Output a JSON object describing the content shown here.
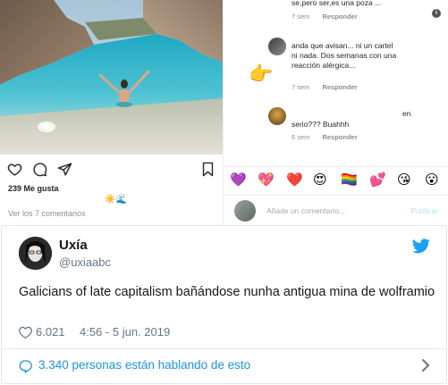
{
  "instagram": {
    "likes": "239 Me gusta",
    "caption_emoji": "☀️🌊",
    "view_comments": "Ver los 7 comentarios",
    "comments": [
      {
        "text": "se,pero ser,es una poza ...",
        "time": "7 sem",
        "reply": "Responder"
      },
      {
        "text_line1": "anda que avisan... ni un cartel",
        "text_line2": "ni nada. Dos semanas con una",
        "text_line3": "reacción alérgica...",
        "time": "7 sem",
        "reply": "Responder"
      },
      {
        "text_prefix": "en",
        "text": "serio??? Buahhh",
        "time": "6 sem",
        "reply": "Responder"
      }
    ],
    "pointer_emoji": "👉",
    "emojis": [
      "💜",
      "💖",
      "❤️",
      "😍",
      "🏳️‍🌈",
      "💕",
      "😘",
      "😮"
    ],
    "comment_placeholder": "Añade un comentario...",
    "publish_label": "Publicar",
    "info_icon": "i"
  },
  "tweet": {
    "name": "Uxía",
    "handle": "@uxiaabc",
    "text": "Galicians of late capitalism bañándose nunha antigua mina de wolframio",
    "likes": "6.021",
    "timestamp": "4:56 - 5 jun. 2019",
    "talking": "3.340 personas están hablando de esto",
    "brand_color": "#1da1f2",
    "link_color": "#1b95e0"
  }
}
